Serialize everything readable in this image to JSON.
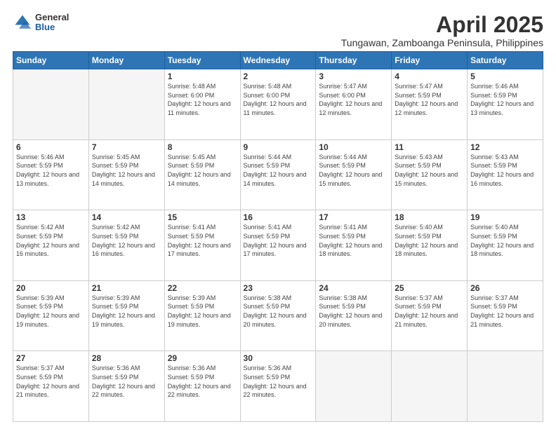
{
  "logo": {
    "general": "General",
    "blue": "Blue"
  },
  "title": "April 2025",
  "subtitle": "Tungawan, Zamboanga Peninsula, Philippines",
  "headers": [
    "Sunday",
    "Monday",
    "Tuesday",
    "Wednesday",
    "Thursday",
    "Friday",
    "Saturday"
  ],
  "weeks": [
    [
      {
        "day": "",
        "sunrise": "",
        "sunset": "",
        "daylight": ""
      },
      {
        "day": "",
        "sunrise": "",
        "sunset": "",
        "daylight": ""
      },
      {
        "day": "1",
        "sunrise": "Sunrise: 5:48 AM",
        "sunset": "Sunset: 6:00 PM",
        "daylight": "Daylight: 12 hours and 11 minutes."
      },
      {
        "day": "2",
        "sunrise": "Sunrise: 5:48 AM",
        "sunset": "Sunset: 6:00 PM",
        "daylight": "Daylight: 12 hours and 11 minutes."
      },
      {
        "day": "3",
        "sunrise": "Sunrise: 5:47 AM",
        "sunset": "Sunset: 6:00 PM",
        "daylight": "Daylight: 12 hours and 12 minutes."
      },
      {
        "day": "4",
        "sunrise": "Sunrise: 5:47 AM",
        "sunset": "Sunset: 5:59 PM",
        "daylight": "Daylight: 12 hours and 12 minutes."
      },
      {
        "day": "5",
        "sunrise": "Sunrise: 5:46 AM",
        "sunset": "Sunset: 5:59 PM",
        "daylight": "Daylight: 12 hours and 13 minutes."
      }
    ],
    [
      {
        "day": "6",
        "sunrise": "Sunrise: 5:46 AM",
        "sunset": "Sunset: 5:59 PM",
        "daylight": "Daylight: 12 hours and 13 minutes."
      },
      {
        "day": "7",
        "sunrise": "Sunrise: 5:45 AM",
        "sunset": "Sunset: 5:59 PM",
        "daylight": "Daylight: 12 hours and 14 minutes."
      },
      {
        "day": "8",
        "sunrise": "Sunrise: 5:45 AM",
        "sunset": "Sunset: 5:59 PM",
        "daylight": "Daylight: 12 hours and 14 minutes."
      },
      {
        "day": "9",
        "sunrise": "Sunrise: 5:44 AM",
        "sunset": "Sunset: 5:59 PM",
        "daylight": "Daylight: 12 hours and 14 minutes."
      },
      {
        "day": "10",
        "sunrise": "Sunrise: 5:44 AM",
        "sunset": "Sunset: 5:59 PM",
        "daylight": "Daylight: 12 hours and 15 minutes."
      },
      {
        "day": "11",
        "sunrise": "Sunrise: 5:43 AM",
        "sunset": "Sunset: 5:59 PM",
        "daylight": "Daylight: 12 hours and 15 minutes."
      },
      {
        "day": "12",
        "sunrise": "Sunrise: 5:43 AM",
        "sunset": "Sunset: 5:59 PM",
        "daylight": "Daylight: 12 hours and 16 minutes."
      }
    ],
    [
      {
        "day": "13",
        "sunrise": "Sunrise: 5:42 AM",
        "sunset": "Sunset: 5:59 PM",
        "daylight": "Daylight: 12 hours and 16 minutes."
      },
      {
        "day": "14",
        "sunrise": "Sunrise: 5:42 AM",
        "sunset": "Sunset: 5:59 PM",
        "daylight": "Daylight: 12 hours and 16 minutes."
      },
      {
        "day": "15",
        "sunrise": "Sunrise: 5:41 AM",
        "sunset": "Sunset: 5:59 PM",
        "daylight": "Daylight: 12 hours and 17 minutes."
      },
      {
        "day": "16",
        "sunrise": "Sunrise: 5:41 AM",
        "sunset": "Sunset: 5:59 PM",
        "daylight": "Daylight: 12 hours and 17 minutes."
      },
      {
        "day": "17",
        "sunrise": "Sunrise: 5:41 AM",
        "sunset": "Sunset: 5:59 PM",
        "daylight": "Daylight: 12 hours and 18 minutes."
      },
      {
        "day": "18",
        "sunrise": "Sunrise: 5:40 AM",
        "sunset": "Sunset: 5:59 PM",
        "daylight": "Daylight: 12 hours and 18 minutes."
      },
      {
        "day": "19",
        "sunrise": "Sunrise: 5:40 AM",
        "sunset": "Sunset: 5:59 PM",
        "daylight": "Daylight: 12 hours and 18 minutes."
      }
    ],
    [
      {
        "day": "20",
        "sunrise": "Sunrise: 5:39 AM",
        "sunset": "Sunset: 5:59 PM",
        "daylight": "Daylight: 12 hours and 19 minutes."
      },
      {
        "day": "21",
        "sunrise": "Sunrise: 5:39 AM",
        "sunset": "Sunset: 5:59 PM",
        "daylight": "Daylight: 12 hours and 19 minutes."
      },
      {
        "day": "22",
        "sunrise": "Sunrise: 5:39 AM",
        "sunset": "Sunset: 5:59 PM",
        "daylight": "Daylight: 12 hours and 19 minutes."
      },
      {
        "day": "23",
        "sunrise": "Sunrise: 5:38 AM",
        "sunset": "Sunset: 5:59 PM",
        "daylight": "Daylight: 12 hours and 20 minutes."
      },
      {
        "day": "24",
        "sunrise": "Sunrise: 5:38 AM",
        "sunset": "Sunset: 5:59 PM",
        "daylight": "Daylight: 12 hours and 20 minutes."
      },
      {
        "day": "25",
        "sunrise": "Sunrise: 5:37 AM",
        "sunset": "Sunset: 5:59 PM",
        "daylight": "Daylight: 12 hours and 21 minutes."
      },
      {
        "day": "26",
        "sunrise": "Sunrise: 5:37 AM",
        "sunset": "Sunset: 5:59 PM",
        "daylight": "Daylight: 12 hours and 21 minutes."
      }
    ],
    [
      {
        "day": "27",
        "sunrise": "Sunrise: 5:37 AM",
        "sunset": "Sunset: 5:59 PM",
        "daylight": "Daylight: 12 hours and 21 minutes."
      },
      {
        "day": "28",
        "sunrise": "Sunrise: 5:36 AM",
        "sunset": "Sunset: 5:59 PM",
        "daylight": "Daylight: 12 hours and 22 minutes."
      },
      {
        "day": "29",
        "sunrise": "Sunrise: 5:36 AM",
        "sunset": "Sunset: 5:59 PM",
        "daylight": "Daylight: 12 hours and 22 minutes."
      },
      {
        "day": "30",
        "sunrise": "Sunrise: 5:36 AM",
        "sunset": "Sunset: 5:59 PM",
        "daylight": "Daylight: 12 hours and 22 minutes."
      },
      {
        "day": "",
        "sunrise": "",
        "sunset": "",
        "daylight": ""
      },
      {
        "day": "",
        "sunrise": "",
        "sunset": "",
        "daylight": ""
      },
      {
        "day": "",
        "sunrise": "",
        "sunset": "",
        "daylight": ""
      }
    ]
  ]
}
